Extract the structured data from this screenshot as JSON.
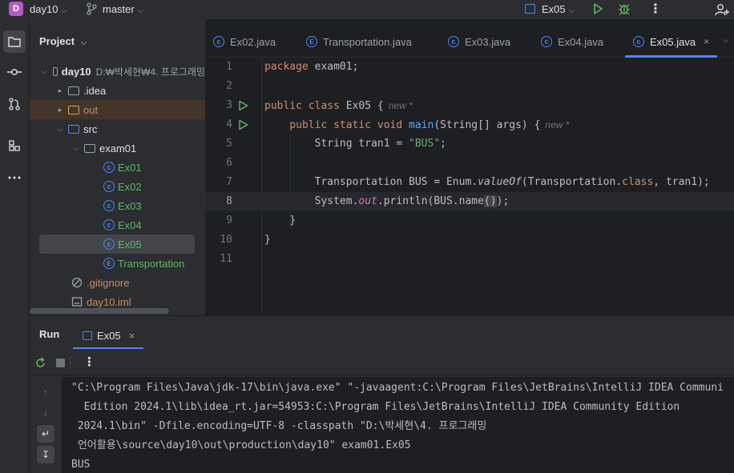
{
  "titlebar": {
    "project_badge": "D",
    "project_name": "day10",
    "branch_name": "master",
    "run_config": "Ex05",
    "more_icon": "⋮"
  },
  "project_panel": {
    "title": "Project",
    "tree": [
      {
        "label": "day10",
        "path": "D:₩박세현₩4. 프로그래밍",
        "kind": "module"
      },
      {
        "label": ".idea",
        "kind": "folder"
      },
      {
        "label": "out",
        "kind": "folder-excluded"
      },
      {
        "label": "src",
        "kind": "folder-source"
      },
      {
        "label": "exam01",
        "kind": "package"
      },
      {
        "label": "Ex01",
        "kind": "class"
      },
      {
        "label": "Ex02",
        "kind": "class"
      },
      {
        "label": "Ex03",
        "kind": "class"
      },
      {
        "label": "Ex04",
        "kind": "class"
      },
      {
        "label": "Ex05",
        "kind": "class",
        "selected": true
      },
      {
        "label": "Transportation",
        "kind": "enum"
      },
      {
        "label": ".gitignore",
        "kind": "ignore-file"
      },
      {
        "label": "day10.iml",
        "kind": "iml-file"
      }
    ]
  },
  "editor": {
    "tabs": [
      {
        "label": "Ex02.java",
        "icon": "class-icon"
      },
      {
        "label": "Transportation.java",
        "icon": "enum-icon"
      },
      {
        "label": "Ex03.java",
        "icon": "class-icon"
      },
      {
        "label": "Ex04.java",
        "icon": "class-icon"
      },
      {
        "label": "Ex05.java",
        "icon": "class-icon",
        "active": true
      }
    ],
    "close_glyph": "×",
    "line_numbers": [
      "1",
      "2",
      "3",
      "4",
      "5",
      "6",
      "7",
      "8",
      "9",
      "10",
      "11"
    ],
    "code": {
      "l1_kw": "package",
      "l1_rest": " exam01;",
      "l3_kw": "public class",
      "l3_rest": " Ex05 {",
      "l3_hint": "new *",
      "l4_kw": "public static void",
      "l4_fn": "main",
      "l4_rest": "(String[] args) {",
      "l4_hint": "new *",
      "l5_a": "String tran1 = ",
      "l5_str": "\"BUS\"",
      "l5_b": ";",
      "l7_a": "Transportation BUS = Enum.",
      "l7_it": "valueOf",
      "l7_b": "(Transportation.",
      "l7_kw": "class",
      "l7_c": ", tran1);",
      "l8_a": "System.",
      "l8_fld": "out",
      "l8_b": ".println(BUS.name",
      "l8_paren": "()",
      "l8_c": ");",
      "l9": "}",
      "l10": "}"
    }
  },
  "run_panel": {
    "title": "Run",
    "tab_label": "Ex05",
    "tab_close": "×",
    "more_icon": "⋮",
    "console": [
      "\"C:\\Program Files\\Java\\jdk-17\\bin\\java.exe\" \"-javaagent:C:\\Program Files\\JetBrains\\IntelliJ IDEA Communi",
      "  Edition 2024.1\\lib\\idea_rt.jar=54953:C:\\Program Files\\JetBrains\\IntelliJ IDEA Community Edition",
      " 2024.1\\bin\" -Dfile.encoding=UTF-8 -classpath \"D:\\박세현\\4. 프로그래밍",
      " 언어활용\\source\\day10\\out\\production\\day10\" exam01.Ex05",
      "BUS"
    ]
  },
  "colors": {
    "accent": "#4e86f7",
    "run_green": "#5fb865",
    "keyword": "#cf8e6d",
    "string": "#6aab73",
    "function": "#56a8f5",
    "field": "#c77dbb"
  }
}
